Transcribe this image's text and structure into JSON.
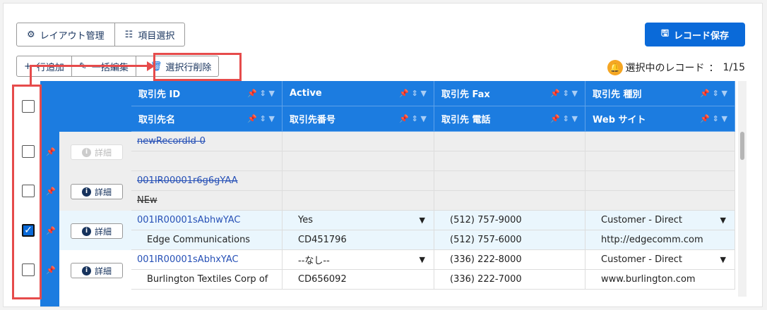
{
  "toolbar": {
    "layout_label": "レイアウト管理",
    "fields_label": "項目選択",
    "save_label": "レコード保存",
    "add_row_label": "行追加",
    "bulk_edit_label": "一括編集",
    "delete_label": "選択行削除",
    "selection_label": "選択中のレコード",
    "selection_count": "1/15",
    "colon": "："
  },
  "columns": {
    "r1": [
      "取引先 ID",
      "Active",
      "取引先 Fax",
      "取引先 種別"
    ],
    "r2": [
      "取引先名",
      "取引先番号",
      "取引先 電話",
      "Web サイト"
    ]
  },
  "detail_label": "詳細",
  "rows": [
    {
      "id": "newRecordId-0",
      "name": "",
      "active": "",
      "number": "",
      "fax": "",
      "phone": "",
      "type": "",
      "web": ""
    },
    {
      "id": "001IR00001r6g6gYAA",
      "name": "NEw",
      "active": "",
      "number": "",
      "fax": "",
      "phone": "",
      "type": "",
      "web": ""
    },
    {
      "id": "001IR00001sAbhwYAC",
      "name": "Edge Communications",
      "active": "Yes",
      "number": "CD451796",
      "fax": "(512) 757-9000",
      "phone": "(512) 757-6000",
      "type": "Customer - Direct",
      "web": "http://edgecomm.com"
    },
    {
      "id": "001IR00001sAbhxYAC",
      "name": "Burlington Textiles Corp of",
      "active": "--なし--",
      "number": "CD656092",
      "fax": "(336) 222-8000",
      "phone": "(336) 222-7000",
      "type": "Customer - Direct",
      "web": "www.burlington.com"
    }
  ],
  "colors": {
    "header": "#1c7ce0",
    "accent": "#0a6ad9",
    "highlight": "#e64b4b",
    "selected_row": "#eaf6fd",
    "deleted_row": "#eeeeee"
  }
}
